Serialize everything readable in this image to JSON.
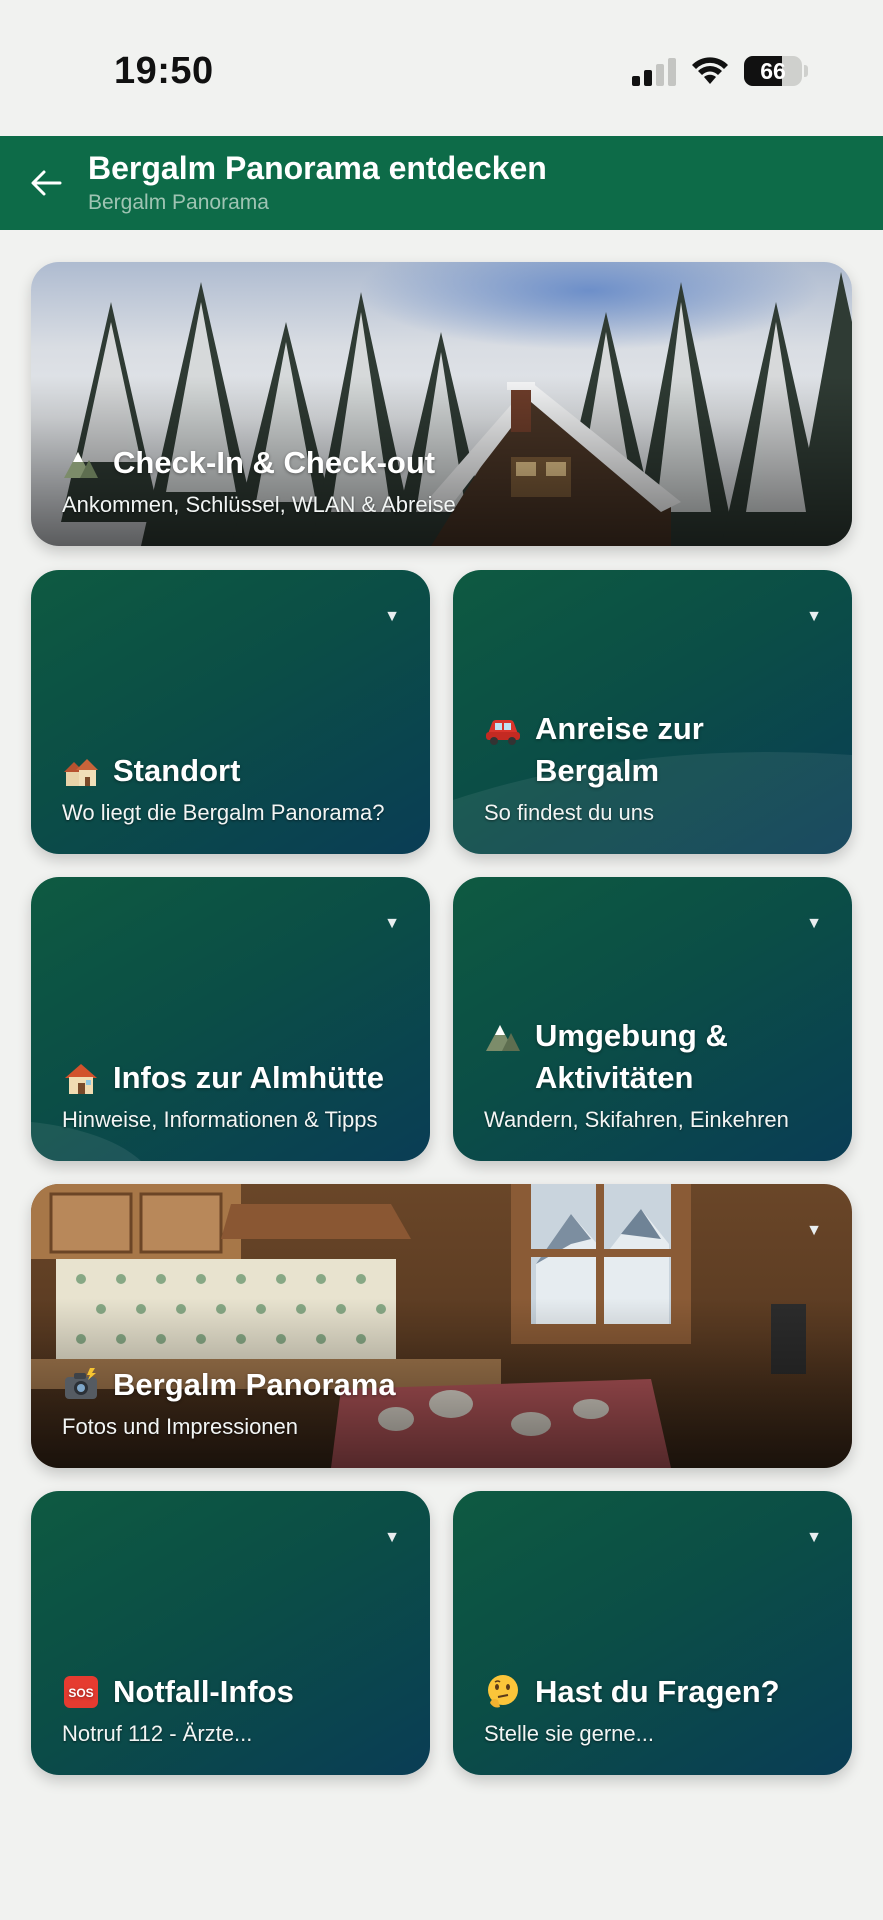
{
  "status_bar": {
    "time": "19:50",
    "battery": "66"
  },
  "header": {
    "title": "Bergalm Panorama entdecken",
    "subtitle": "Bergalm Panorama"
  },
  "cards": {
    "checkin": {
      "title": "Check-In & Check-out",
      "subtitle": "Ankommen, Schlüssel, WLAN & Abreise",
      "icon": "mountain-icon"
    },
    "standort": {
      "title": "Standort",
      "subtitle": "Wo liegt die Bergalm Panorama?",
      "icon": "houses-icon"
    },
    "anreise": {
      "title": "Anreise zur Bergalm",
      "subtitle": "So findest du uns",
      "icon": "car-icon"
    },
    "infos": {
      "title": "Infos zur Almhütte",
      "subtitle": "Hinweise, Informationen & Tipps",
      "icon": "house-icon"
    },
    "umgebung": {
      "title": "Umgebung & Aktivitäten",
      "subtitle": "Wandern, Skifahren, Einkehren",
      "icon": "mountain-icon"
    },
    "panorama": {
      "title": "Bergalm Panorama",
      "subtitle": "Fotos und Impressionen",
      "icon": "camera-flash-icon"
    },
    "notfall": {
      "title": "Notfall-Infos",
      "subtitle": "Notruf 112 - Ärzte...",
      "icon": "sos-icon"
    },
    "fragen": {
      "title": "Hast du Fragen?",
      "subtitle": "Stelle sie gerne...",
      "icon": "thinking-face-icon"
    }
  },
  "colors": {
    "header_green": "#0d6b48",
    "card_green": "#0e5a41",
    "card_blue": "#0a3d55",
    "background": "#f1f2f0"
  }
}
